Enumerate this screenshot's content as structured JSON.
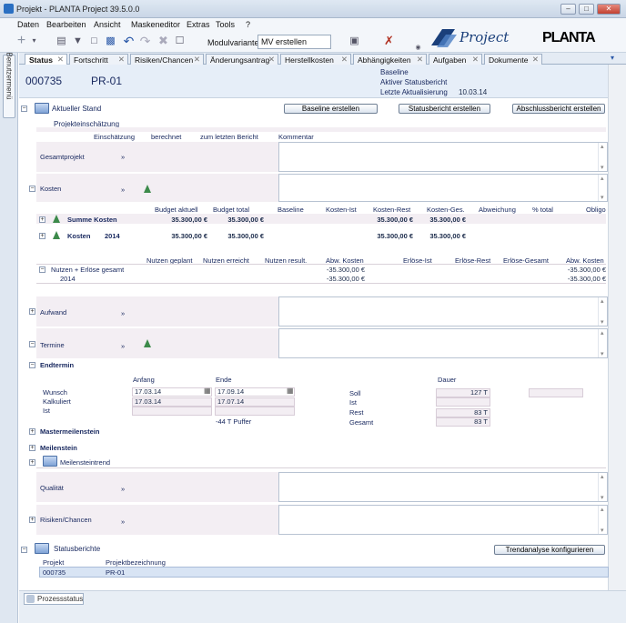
{
  "window": {
    "title": "Projekt - PLANTA Project 39.5.0.0",
    "btn_min": "–",
    "btn_max": "□",
    "btn_close": "✕"
  },
  "menu": [
    "Daten",
    "Bearbeiten",
    "Ansicht",
    "Maskeneditor",
    "Extras",
    "Tools",
    "?"
  ],
  "toolbar": {
    "module_label": "Modulvariante:",
    "module_value": "MV erstellen",
    "icons": [
      "add-icon",
      "save-icon",
      "filter-icon",
      "new-doc-icon",
      "print-icon",
      "undo-icon",
      "redo-icon",
      "delete-icon",
      "preview-icon",
      "window-icon",
      "tools-icon"
    ]
  },
  "logo": {
    "project": "Project",
    "planta": "PLANTA"
  },
  "side": {
    "tab_label": "Benutzermenü"
  },
  "tabs": [
    "Status",
    "Fortschritt",
    "Risiken/Chancen",
    "Änderungsantrag",
    "Herstellkosten",
    "Abhängigkeiten",
    "Aufgaben",
    "Dokumente"
  ],
  "header": {
    "project_id": "000735",
    "project_name": "PR-01",
    "baseline": "Baseline",
    "active_status": "Aktiver Statusbericht",
    "last_update": "Letzte Aktualisierung",
    "last_update_date": "10.03.14"
  },
  "current": {
    "title": "Aktueller Stand",
    "btn_baseline": "Baseline erstellen",
    "btn_status": "Statusbericht erstellen",
    "btn_final": "Abschlussbericht erstellen",
    "assessment": "Projekteinschätzung",
    "col_assess": "Einschätzung",
    "col_calc": "berechnet",
    "col_last": "zum letzten Bericht",
    "col_comment": "Kommentar",
    "overall": "Gesamtprojekt",
    "arrow": "»"
  },
  "costs": {
    "title": "Kosten",
    "headers": [
      "Budget aktuell",
      "Budget total",
      "Baseline",
      "Kosten-Ist",
      "Kosten-Rest",
      "Kosten-Ges.",
      "Abweichung",
      "% total",
      "Obligo"
    ],
    "row1_label": "Summe Kosten",
    "row1_budget": "35.300,00 €",
    "row1_total": "35.300,00 €",
    "row1_rest": "35.300,00 €",
    "row1_ges": "35.300,00 €",
    "row2_label": "Kosten",
    "row2_year": "2014",
    "row2_budget": "35.300,00 €",
    "row2_total": "35.300,00 €",
    "row2_rest": "35.300,00 €",
    "row2_ges": "35.300,00 €"
  },
  "benefit": {
    "headers": [
      "Nutzen geplant",
      "Nutzen erreicht",
      "Nutzen result.",
      "Abw. Kosten",
      "Erlöse-Ist",
      "Erlöse-Rest",
      "Erlöse-Gesamt",
      "Abw. Kosten"
    ],
    "row1_label": "Nutzen + Erlöse gesamt",
    "row1_abw": "-35.300,00 €",
    "row1_abw2": "-35.300,00 €",
    "row2_label": "2014",
    "row2_abw": "-35.300,00 €",
    "row2_abw2": "-35.300,00 €"
  },
  "effort": {
    "title": "Aufwand"
  },
  "dates": {
    "title": "Termine"
  },
  "enddate": {
    "title": "Endtermin",
    "col_start": "Anfang",
    "col_end": "Ende",
    "col_duration": "Dauer",
    "wish": "Wunsch",
    "calc": "Kalkuliert",
    "actual": "Ist",
    "wish_start": "17.03.14",
    "wish_end": "17.09.14",
    "calc_start": "17.03.14",
    "calc_end": "17.07.14",
    "buffer": "-44 T Puffer",
    "soll": "Soll",
    "ist": "Ist",
    "rest": "Rest",
    "total": "Gesamt",
    "soll_val": "127 T",
    "rest_val": "83 T",
    "total_val": "83 T"
  },
  "milestones": {
    "master": "Mastermeilenstein",
    "milestone": "Meilenstein",
    "trend": "Meilensteintrend"
  },
  "quality": {
    "title": "Qualität"
  },
  "risks": {
    "title": "Risiken/Chancen"
  },
  "reports": {
    "title": "Statusberichte",
    "btn_trend": "Trendanalyse konfigurieren",
    "col_project": "Projekt",
    "col_name": "Projektbezeichnung",
    "row_id": "000735",
    "row_name": "PR-01"
  },
  "statusbar": {
    "tab": "Prozessstatus"
  },
  "colors": {
    "band": "#f3eef3",
    "triangle": "#3c8a4a",
    "header": "#e6eef8"
  }
}
